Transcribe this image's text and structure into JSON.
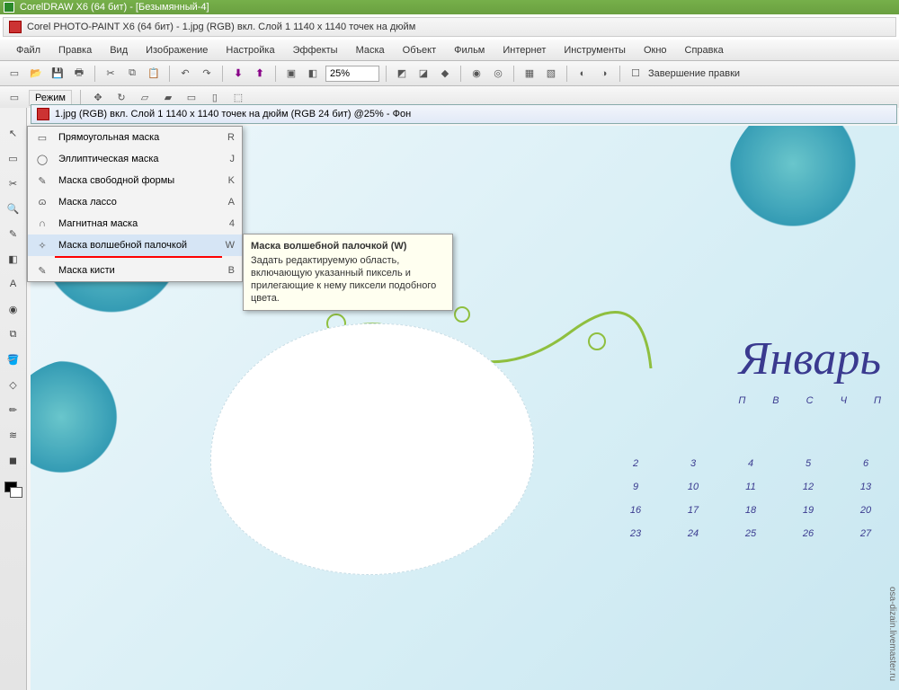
{
  "outer_title": "CorelDRAW X6 (64 бит) - [Безымянный-4]",
  "inner_title": "Corel PHOTO-PAINT X6 (64 бит) - 1.jpg (RGB) вкл. Слой 1 1140 x 1140 точек на дюйм",
  "menu": [
    "Файл",
    "Правка",
    "Вид",
    "Изображение",
    "Настройка",
    "Эффекты",
    "Маска",
    "Объект",
    "Фильм",
    "Интернет",
    "Инструменты",
    "Окно",
    "Справка"
  ],
  "zoom": "25%",
  "finish_edit": "Завершение правки",
  "mode_label": "Режим",
  "doc_tab": "1.jpg (RGB) вкл. Слой 1 1140 x 1140 точек на дюйм  (RGB 24 бит) @25% - Фон",
  "flyout": [
    {
      "icon": "▭",
      "label": "Прямоугольная маска",
      "shortcut": "R"
    },
    {
      "icon": "◯",
      "label": "Эллиптическая маска",
      "shortcut": "J"
    },
    {
      "icon": "✎",
      "label": "Маска свободной формы",
      "shortcut": "K"
    },
    {
      "icon": "ɷ",
      "label": "Маска лассо",
      "shortcut": "A"
    },
    {
      "icon": "∩",
      "label": "Магнитная маска",
      "shortcut": "4"
    },
    {
      "icon": "✧",
      "label": "Маска волшебной палочкой",
      "shortcut": "W",
      "selected": true,
      "underline": true
    },
    {
      "icon": "✎",
      "label": "Маска кисти",
      "shortcut": "B"
    }
  ],
  "tooltip": {
    "title": "Маска волшебной палочкой (W)",
    "body": "Задать редактируемую область, включающую указанный пиксель и прилегающие к нему пиксели подобного цвета."
  },
  "calendar": {
    "month": "Январь",
    "dow": [
      "П",
      "В",
      "С",
      "Ч",
      "П"
    ],
    "rows": [
      [
        "2",
        "3",
        "4",
        "5",
        "6"
      ],
      [
        "9",
        "10",
        "11",
        "12",
        "13"
      ],
      [
        "16",
        "17",
        "18",
        "19",
        "20"
      ],
      [
        "23",
        "24",
        "25",
        "26",
        "27"
      ]
    ]
  },
  "watermark": "osa-dizain.livemaster.ru"
}
